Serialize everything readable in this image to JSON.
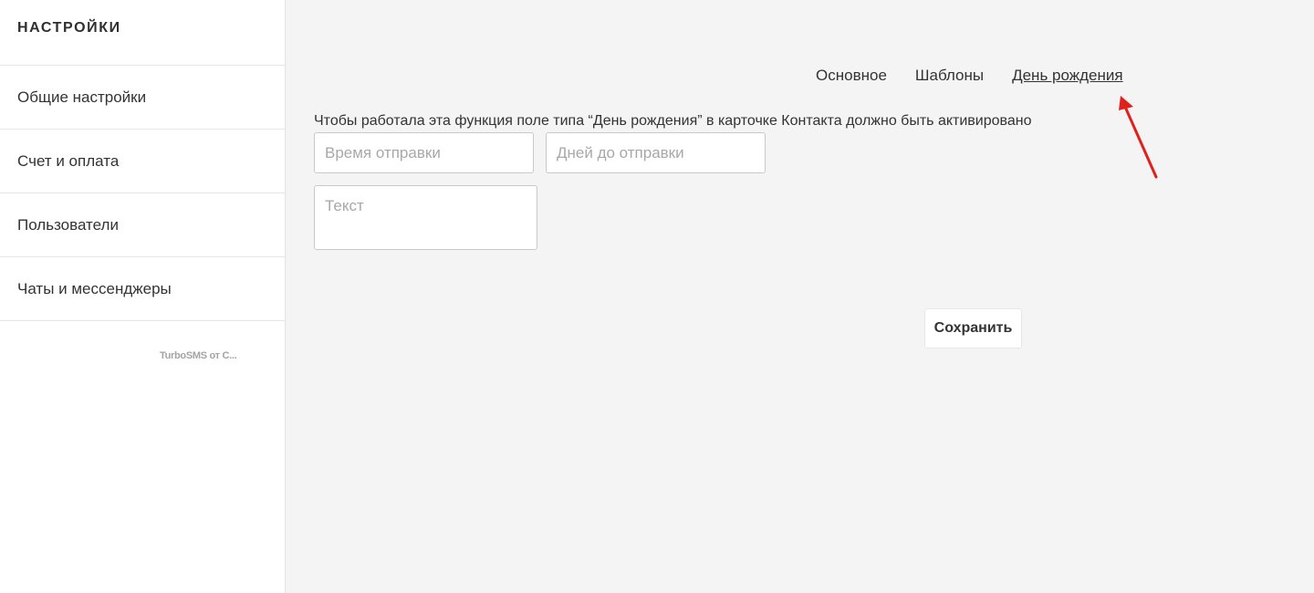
{
  "sidebar": {
    "title": "НАСТРОЙКИ",
    "items": [
      {
        "label": "Общие настройки"
      },
      {
        "label": "Счет и оплата"
      },
      {
        "label": "Пользователи"
      },
      {
        "label": "Чаты и мессенджеры"
      }
    ],
    "footer": "TurboSMS от C..."
  },
  "tabs": [
    {
      "label": "Основное",
      "active": false
    },
    {
      "label": "Шаблоны",
      "active": false
    },
    {
      "label": "День рождения",
      "active": true
    }
  ],
  "main": {
    "notice": "Чтобы работала эта функция поле типа “День рождения” в карточке Контакта должно быть активировано",
    "send_time": {
      "value": "",
      "placeholder": "Время отправки"
    },
    "days_before": {
      "value": "",
      "placeholder": "Дней до отправки"
    },
    "text": {
      "value": "",
      "placeholder": "Текст"
    },
    "save_label": "Сохранить"
  },
  "annotation": {
    "arrow_color": "#e0201b"
  }
}
